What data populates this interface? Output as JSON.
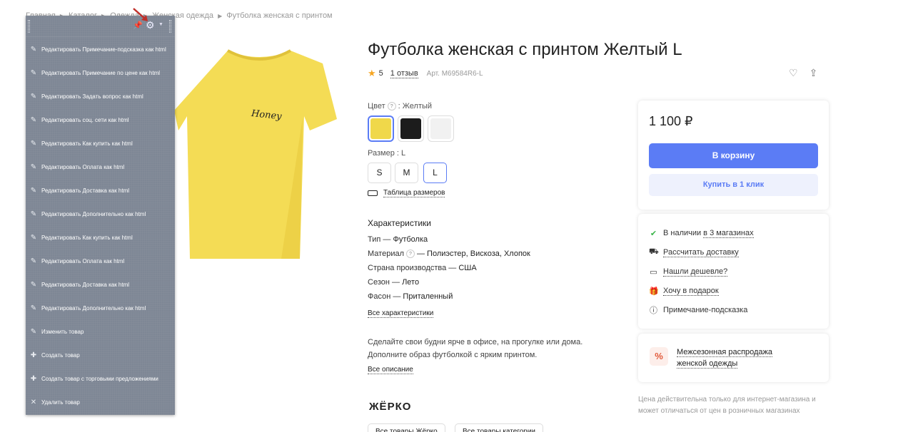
{
  "breadcrumb": [
    "Главная",
    "Каталог",
    "Одежда",
    "Женская одежда",
    "Футболка женская с принтом"
  ],
  "admin_panel": {
    "items": [
      {
        "label": "Редактировать Примечание-подсказка как html",
        "icon": "pencil-icon"
      },
      {
        "label": "Редактировать Примечание по цене как html",
        "icon": "pencil-icon"
      },
      {
        "label": "Редактировать Задать вопрос как html",
        "icon": "pencil-icon"
      },
      {
        "label": "Редактировать соц. сети как html",
        "icon": "pencil-icon"
      },
      {
        "label": "Редактировать Как купить как html",
        "icon": "pencil-icon"
      },
      {
        "label": "Редактировать Оплата как html",
        "icon": "pencil-icon"
      },
      {
        "label": "Редактировать Доставка как html",
        "icon": "pencil-icon"
      },
      {
        "label": "Редактировать Дополнительно как html",
        "icon": "pencil-icon"
      },
      {
        "label": "Редактировать Как купить как html",
        "icon": "pencil-icon"
      },
      {
        "label": "Редактировать Оплата как html",
        "icon": "pencil-icon"
      },
      {
        "label": "Редактировать Доставка как html",
        "icon": "pencil-icon"
      },
      {
        "label": "Редактировать Дополнительно как html",
        "icon": "pencil-icon"
      },
      {
        "label": "Изменить товар",
        "icon": "pencil-icon"
      },
      {
        "label": "Создать товар",
        "icon": "plus-icon"
      },
      {
        "label": "Создать товар с торговыми предложениями",
        "icon": "plus-icon"
      },
      {
        "label": "Удалить товар",
        "icon": "close-icon"
      }
    ]
  },
  "product": {
    "title": "Футболка женская с принтом Желтый L",
    "rating": "5",
    "reviews": "1 отзыв",
    "article": "Арт. M69584R6-L",
    "print_text": "Honey",
    "color_label": "Цвет",
    "color_value": ": Желтый",
    "colors": [
      "#f0d84a",
      "#1c1c1c",
      "#f1f1f1"
    ],
    "size_label": "Размер : L",
    "sizes": [
      "S",
      "M",
      "L"
    ],
    "size_table": "Таблица размеров",
    "characteristics_title": "Характеристики",
    "characteristics": [
      {
        "name": "Тип —",
        "value": "Футболка"
      },
      {
        "name": "Материал",
        "value": "— Полиэстер, Вискоза, Хлопок"
      },
      {
        "name": "Страна производства —",
        "value": "США"
      },
      {
        "name": "Сезон —",
        "value": "Лето"
      },
      {
        "name": "Фасон —",
        "value": "Приталенный"
      }
    ],
    "all_characteristics": "Все характеристики",
    "description_line1": "Сделайте свои будни ярче в офисе, на прогулке или дома.",
    "description_line2": "Дополните образ футболкой с ярким принтом.",
    "all_description": "Все описание",
    "brand": "ЖЁРКО",
    "brand_links": [
      "Все товары Жёрко",
      "Все товары категории"
    ]
  },
  "buy_box": {
    "price": "1 100 ₽",
    "cart_button": "В корзину",
    "one_click": "Купить в 1 клик"
  },
  "info": [
    {
      "icon": "check-circle-icon",
      "text": "В наличии",
      "link": "в 3 магазинах"
    },
    {
      "icon": "truck-icon",
      "text": "",
      "link": "Рассчитать доставку"
    },
    {
      "icon": "wallet-icon",
      "text": "",
      "link": "Нашли дешевле?"
    },
    {
      "icon": "gift-icon",
      "text": "",
      "link": "Хочу в подарок"
    },
    {
      "icon": "info-icon",
      "text": "Примечание-подсказка",
      "link": ""
    }
  ],
  "promo": {
    "icon": "percent-icon",
    "line1": "Межсезонная распродажа",
    "line2": "женской одежды"
  },
  "note": {
    "line1": "Цена действительна только для интернет-магазина и",
    "line2": "может отличаться от цен в розничных магазинах"
  }
}
